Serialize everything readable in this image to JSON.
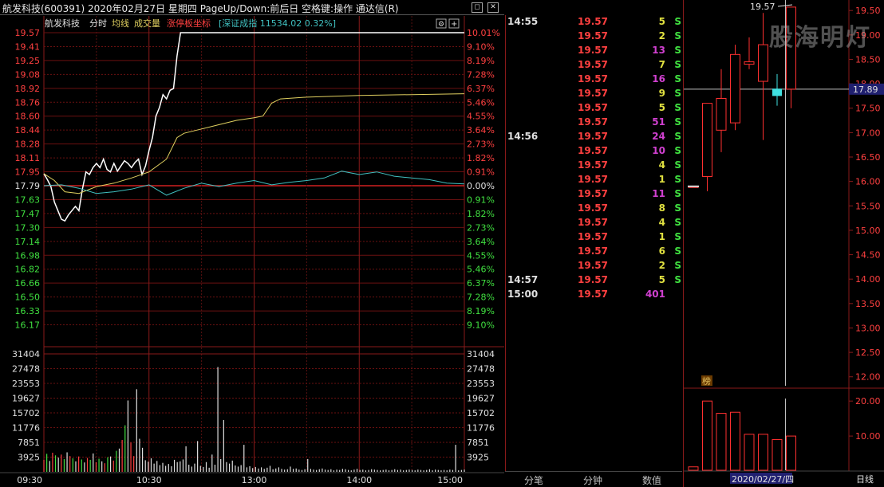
{
  "window": {
    "title": "航发科技(600391)  2020年02月27日 星期四  PageUp/Down:前后日  空格键:操作  通达信(R)",
    "btn_restore": "◻",
    "btn_close": "✕"
  },
  "legend": {
    "name": "航发科技",
    "intraday": "分时",
    "avg_line": "均线",
    "volume": "成交量",
    "limit_axis": "涨停板坐标",
    "index_info": "[深证成指 11534.02 0.32%]",
    "btn_settings": "⚙",
    "btn_add": "+"
  },
  "price_axis": {
    "prices": [
      "19.57",
      "19.41",
      "19.25",
      "19.08",
      "18.92",
      "18.76",
      "18.60",
      "18.44",
      "18.28",
      "18.11",
      "17.95",
      "17.79",
      "17.63",
      "17.47",
      "17.30",
      "17.14",
      "16.98",
      "16.82",
      "16.66",
      "16.50",
      "16.33",
      "16.17"
    ],
    "percents": [
      "10.01%",
      "9.10%",
      "8.19%",
      "7.28%",
      "6.37%",
      "5.46%",
      "4.55%",
      "3.64%",
      "2.73%",
      "1.82%",
      "0.91%",
      "0.00%",
      "0.91%",
      "1.82%",
      "2.73%",
      "3.64%",
      "4.55%",
      "5.46%",
      "6.37%",
      "7.28%",
      "8.19%",
      "9.10%"
    ],
    "prev_close": 17.79,
    "limit_up": 19.57,
    "limit_down": 16.01
  },
  "volume_axis": {
    "labels": [
      "31404",
      "27478",
      "23553",
      "19627",
      "15702",
      "11776",
      "7851",
      "3925"
    ],
    "max": 31404
  },
  "time_axis": [
    "09:30",
    "10:30",
    "13:00",
    "14:00",
    "15:00"
  ],
  "chart_data": {
    "type": "line",
    "title": "航发科技 分时",
    "x_unit": "minutes from 09:30",
    "ylim": [
      16.01,
      19.57
    ],
    "series": [
      {
        "name": "分时",
        "color": "#ffffff",
        "points": [
          [
            0,
            17.93
          ],
          [
            2,
            17.86
          ],
          [
            4,
            17.78
          ],
          [
            6,
            17.6
          ],
          [
            8,
            17.5
          ],
          [
            10,
            17.4
          ],
          [
            12,
            17.38
          ],
          [
            14,
            17.45
          ],
          [
            16,
            17.5
          ],
          [
            18,
            17.55
          ],
          [
            20,
            17.5
          ],
          [
            22,
            17.75
          ],
          [
            24,
            17.95
          ],
          [
            26,
            17.92
          ],
          [
            28,
            18.0
          ],
          [
            30,
            18.05
          ],
          [
            32,
            18.0
          ],
          [
            34,
            18.1
          ],
          [
            36,
            17.98
          ],
          [
            38,
            17.95
          ],
          [
            40,
            18.05
          ],
          [
            42,
            17.96
          ],
          [
            44,
            18.02
          ],
          [
            46,
            18.08
          ],
          [
            48,
            18.05
          ],
          [
            50,
            18.0
          ],
          [
            52,
            18.06
          ],
          [
            54,
            18.1
          ],
          [
            56,
            17.92
          ],
          [
            58,
            18.02
          ],
          [
            60,
            18.2
          ],
          [
            62,
            18.35
          ],
          [
            64,
            18.6
          ],
          [
            66,
            18.7
          ],
          [
            68,
            18.85
          ],
          [
            70,
            18.8
          ],
          [
            72,
            18.9
          ],
          [
            74,
            18.92
          ],
          [
            76,
            19.3
          ],
          [
            78,
            19.57
          ],
          [
            240,
            19.57
          ]
        ]
      },
      {
        "name": "均线",
        "color": "#e0d060",
        "points": [
          [
            0,
            17.93
          ],
          [
            6,
            17.85
          ],
          [
            12,
            17.72
          ],
          [
            20,
            17.7
          ],
          [
            30,
            17.78
          ],
          [
            40,
            17.82
          ],
          [
            50,
            17.88
          ],
          [
            60,
            17.95
          ],
          [
            70,
            18.1
          ],
          [
            76,
            18.35
          ],
          [
            80,
            18.4
          ],
          [
            90,
            18.45
          ],
          [
            100,
            18.5
          ],
          [
            110,
            18.55
          ],
          [
            120,
            18.58
          ],
          [
            125,
            18.6
          ],
          [
            130,
            18.75
          ],
          [
            135,
            18.8
          ],
          [
            150,
            18.82
          ],
          [
            180,
            18.84
          ],
          [
            210,
            18.85
          ],
          [
            240,
            18.86
          ]
        ]
      },
      {
        "name": "深证成指",
        "color": "#40c0c0",
        "points": [
          [
            0,
            17.79
          ],
          [
            10,
            17.8
          ],
          [
            20,
            17.76
          ],
          [
            30,
            17.7
          ],
          [
            40,
            17.72
          ],
          [
            50,
            17.75
          ],
          [
            60,
            17.8
          ],
          [
            70,
            17.68
          ],
          [
            80,
            17.76
          ],
          [
            90,
            17.82
          ],
          [
            100,
            17.78
          ],
          [
            110,
            17.82
          ],
          [
            120,
            17.85
          ],
          [
            130,
            17.8
          ],
          [
            140,
            17.83
          ],
          [
            150,
            17.85
          ],
          [
            160,
            17.88
          ],
          [
            170,
            17.96
          ],
          [
            180,
            17.92
          ],
          [
            190,
            17.95
          ],
          [
            200,
            17.9
          ],
          [
            210,
            17.88
          ],
          [
            220,
            17.86
          ],
          [
            230,
            17.82
          ],
          [
            240,
            17.81
          ]
        ]
      }
    ],
    "volume_bars": [
      3200,
      4800,
      2900,
      5100,
      4400,
      3800,
      4600,
      3400,
      5200,
      4200,
      3600,
      2800,
      4100,
      3300,
      2500,
      3700,
      3200,
      4900,
      2600,
      3500,
      2800,
      2300,
      3900,
      4100,
      3000,
      5600,
      6200,
      8500,
      12400,
      19000,
      7800,
      4200,
      22000,
      8800,
      6400,
      3100,
      2700,
      3600,
      2200,
      2900,
      1800,
      2400,
      1600,
      2100,
      1500,
      3200,
      2600,
      2800,
      3300,
      6800,
      1900,
      1400,
      2200,
      8200,
      1600,
      1300,
      2600,
      1100,
      4600,
      1900,
      27900,
      3400,
      13800,
      2600,
      2200,
      3000,
      1700,
      1400,
      1800,
      7200,
      1200,
      1500,
      1000,
      1300,
      900,
      1200,
      800,
      1100,
      1600,
      700,
      900,
      1200,
      800,
      600,
      700,
      1400,
      800,
      900,
      600,
      500,
      700,
      3400,
      800,
      600,
      500,
      700,
      900,
      600,
      500,
      700,
      400,
      600,
      500,
      800,
      700,
      500,
      400,
      600,
      800,
      500,
      600,
      400,
      500,
      700,
      600,
      500,
      400,
      500,
      600,
      400,
      500,
      700,
      500,
      600,
      400,
      500,
      600,
      500,
      400,
      600,
      500,
      400,
      500,
      700,
      400,
      600,
      500,
      400,
      500,
      400,
      600,
      500,
      7200,
      400,
      500,
      600
    ]
  },
  "ticks": [
    {
      "time": "14:55",
      "price": "19.57",
      "vol": "5",
      "vol_color": "#e0e040",
      "flag": "S"
    },
    {
      "time": "",
      "price": "19.57",
      "vol": "2",
      "vol_color": "#e0e040",
      "flag": "S"
    },
    {
      "time": "",
      "price": "19.57",
      "vol": "13",
      "vol_color": "#d040d0",
      "flag": "S"
    },
    {
      "time": "",
      "price": "19.57",
      "vol": "7",
      "vol_color": "#e0e040",
      "flag": "S"
    },
    {
      "time": "",
      "price": "19.57",
      "vol": "16",
      "vol_color": "#d040d0",
      "flag": "S"
    },
    {
      "time": "",
      "price": "19.57",
      "vol": "9",
      "vol_color": "#e0e040",
      "flag": "S"
    },
    {
      "time": "",
      "price": "19.57",
      "vol": "5",
      "vol_color": "#e0e040",
      "flag": "S"
    },
    {
      "time": "",
      "price": "19.57",
      "vol": "51",
      "vol_color": "#d040d0",
      "flag": "S"
    },
    {
      "time": "14:56",
      "price": "19.57",
      "vol": "24",
      "vol_color": "#d040d0",
      "flag": "S"
    },
    {
      "time": "",
      "price": "19.57",
      "vol": "10",
      "vol_color": "#d040d0",
      "flag": "S"
    },
    {
      "time": "",
      "price": "19.57",
      "vol": "4",
      "vol_color": "#e0e040",
      "flag": "S"
    },
    {
      "time": "",
      "price": "19.57",
      "vol": "1",
      "vol_color": "#e0e040",
      "flag": "S"
    },
    {
      "time": "",
      "price": "19.57",
      "vol": "11",
      "vol_color": "#d040d0",
      "flag": "S"
    },
    {
      "time": "",
      "price": "19.57",
      "vol": "8",
      "vol_color": "#e0e040",
      "flag": "S"
    },
    {
      "time": "",
      "price": "19.57",
      "vol": "4",
      "vol_color": "#e0e040",
      "flag": "S"
    },
    {
      "time": "",
      "price": "19.57",
      "vol": "1",
      "vol_color": "#e0e040",
      "flag": "S"
    },
    {
      "time": "",
      "price": "19.57",
      "vol": "6",
      "vol_color": "#e0e040",
      "flag": "S"
    },
    {
      "time": "",
      "price": "19.57",
      "vol": "2",
      "vol_color": "#e0e040",
      "flag": "S"
    },
    {
      "time": "14:57",
      "price": "19.57",
      "vol": "5",
      "vol_color": "#e0e040",
      "flag": "S"
    },
    {
      "time": "15:00",
      "price": "19.57",
      "vol": "401",
      "vol_color": "#d040d0",
      "flag": ""
    }
  ],
  "tabs": [
    "分笔",
    "分钟",
    "数值"
  ],
  "daily": {
    "watermark": "股海明灯",
    "high_label": "19.57",
    "current_price": "17.89",
    "price_axis": [
      "19.50",
      "19.00",
      "18.50",
      "18.00",
      "17.50",
      "17.00",
      "16.50",
      "16.00",
      "15.50",
      "15.00",
      "14.50",
      "14.00",
      "13.50",
      "13.00",
      "12.50",
      "12.00"
    ],
    "vol_axis": [
      "20.00",
      "10.00"
    ],
    "badge": "榜",
    "date": "2020/02/27/四",
    "period": "日线",
    "candles": [
      {
        "o": 15.9,
        "c": 15.9,
        "h": 15.9,
        "l": 15.9
      },
      {
        "o": 16.1,
        "c": 17.6,
        "h": 17.6,
        "l": 15.8
      },
      {
        "o": 17.05,
        "c": 17.7,
        "h": 18.3,
        "l": 16.6
      },
      {
        "o": 17.2,
        "c": 18.6,
        "h": 18.8,
        "l": 17.05
      },
      {
        "o": 18.4,
        "c": 18.45,
        "h": 18.95,
        "l": 18.3
      },
      {
        "o": 18.05,
        "c": 18.8,
        "h": 19.45,
        "l": 16.85
      },
      {
        "o": 17.9,
        "c": 17.75,
        "h": 18.2,
        "l": 17.55
      },
      {
        "o": 17.89,
        "c": 19.57,
        "h": 19.57,
        "l": 17.5
      }
    ],
    "volumes": [
      1.2,
      20.0,
      16.5,
      16.8,
      10.5,
      10.5,
      9.0,
      10.0
    ]
  }
}
